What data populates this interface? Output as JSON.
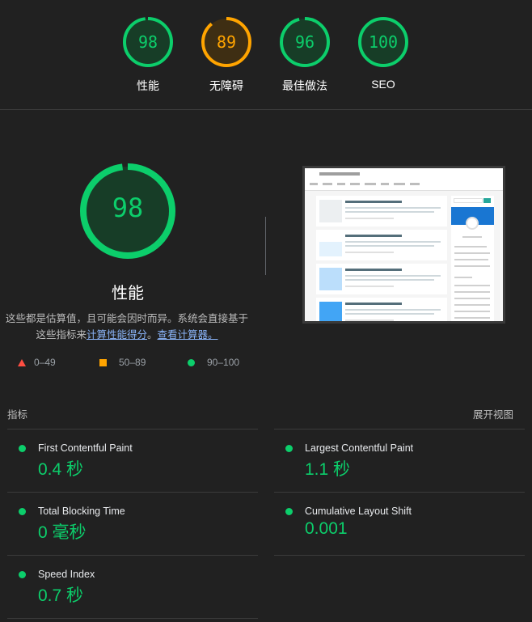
{
  "colors": {
    "pass": "#0cce6b",
    "average": "#ffa400",
    "fail": "#ff4e42"
  },
  "categories": [
    {
      "score": "98",
      "value": 98,
      "label": "性能",
      "status": "pass"
    },
    {
      "score": "89",
      "value": 89,
      "label": "无障碍",
      "status": "average"
    },
    {
      "score": "96",
      "value": 96,
      "label": "最佳做法",
      "status": "pass"
    },
    {
      "score": "100",
      "value": 100,
      "label": "SEO",
      "status": "pass"
    }
  ],
  "performance": {
    "score": "98",
    "value": 98,
    "title": "性能",
    "description_line1": "这些都是估算值，且可能会因时而异。系统会直接基于",
    "description_prefix": "这些指标来",
    "calc_link": "计算性能得分",
    "description_mid": "。",
    "calculator_link": "查看计算器。"
  },
  "legend": {
    "fail": "0–49",
    "average": "50–89",
    "pass": "90–100"
  },
  "metrics_section": {
    "title": "指标",
    "expand": "展开视图"
  },
  "metrics": [
    {
      "name": "First Contentful Paint",
      "value": "0.4 秒"
    },
    {
      "name": "Largest Contentful Paint",
      "value": "1.1 秒"
    },
    {
      "name": "Total Blocking Time",
      "value": "0 毫秒"
    },
    {
      "name": "Cumulative Layout Shift",
      "value": "0.001"
    },
    {
      "name": "Speed Index",
      "value": "0.7 秒"
    }
  ]
}
